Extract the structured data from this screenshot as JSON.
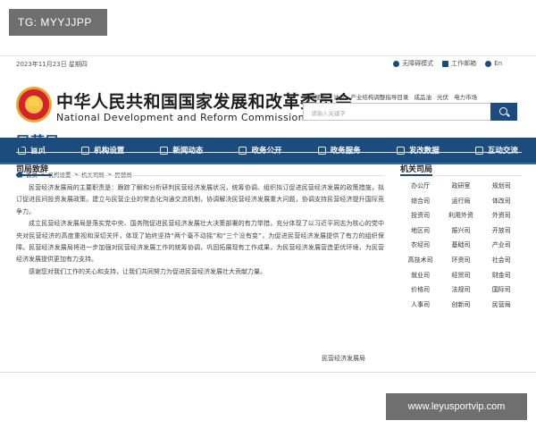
{
  "watermarks": {
    "top": "TG: MYYJJPP",
    "bottom": "www.leyusportvip.com"
  },
  "topbar": {
    "date": "2023年11月23日 星期四",
    "links": [
      {
        "label": "无障碍模式",
        "icon": "accessibility-icon"
      },
      {
        "label": "工作邮箱",
        "icon": "mail-icon"
      },
      {
        "label": "En",
        "icon": "globe-icon"
      }
    ]
  },
  "header": {
    "site_name_cn": "中华人民共和国国家发展和改革委员会",
    "site_name_en": "National Development and Reform Commission",
    "hot_label": "热门搜索:",
    "hot_terms": [
      "油价",
      "产业结构调整指导目录",
      "成品油",
      "光伏",
      "电力市场"
    ],
    "search_placeholder": "请输入关键字"
  },
  "nav": [
    {
      "label": "首页",
      "icon": "home-icon"
    },
    {
      "label": "机构设置",
      "icon": "building-icon"
    },
    {
      "label": "新闻动态",
      "icon": "news-icon"
    },
    {
      "label": "政务公开",
      "icon": "globe-icon"
    },
    {
      "label": "政务服务",
      "icon": "service-icon"
    },
    {
      "label": "发改数据",
      "icon": "chart-icon"
    },
    {
      "label": "互动交流",
      "icon": "chat-icon"
    }
  ],
  "breadcrumb": [
    "首页",
    "机构设置",
    "机关司局",
    "民营局"
  ],
  "page_title": "民营局",
  "section_title": "司局致辞",
  "paragraphs": [
    "民营经济发展局的主要职责是：跟踪了解和分析研判民营经济发展状况，统筹协调、组织拟订促进民营经济发展的政策措施，拟订促进民间投资发展政策。建立与民营企业的常态化沟通交流机制，协调解决民营经济发展重大问题，协调支持民营经济提升国际竞争力。",
    "成立民营经济发展局是落实党中央、国务院促进民营经济发展壮大决策部署的有力举措，充分体现了以习近平同志为核心的党中央对民营经济的高度重视和深切关怀，体现了始终坚持“两个毫不动摇”和“三个没有变”，为促进民营经济发展提供了有力的组织保障。民营经济发展局将进一步加强对民营经济发展工作的统筹协调，巩固拓展现有工作成果，为民营经济发展营造更优环境，为民营经济发展提供更加有力支持。",
    "感谢您对我们工作的关心和支持，让我们共同努力为促进民营经济发展壮大贡献力量。"
  ],
  "signature": "民营经济发展局",
  "sidebar": {
    "title": "机关司局",
    "items": [
      "办公厅",
      "政研室",
      "规划司",
      "综合司",
      "运行局",
      "体改司",
      "投资司",
      "利用外资",
      "外资司",
      "地区司",
      "振兴司",
      "开放司",
      "农经司",
      "基础司",
      "产业司",
      "高技术司",
      "环资司",
      "社会司",
      "就业司",
      "经贸司",
      "财金司",
      "价格司",
      "法规司",
      "国际司",
      "人事司",
      "创新司",
      "民营局"
    ]
  }
}
